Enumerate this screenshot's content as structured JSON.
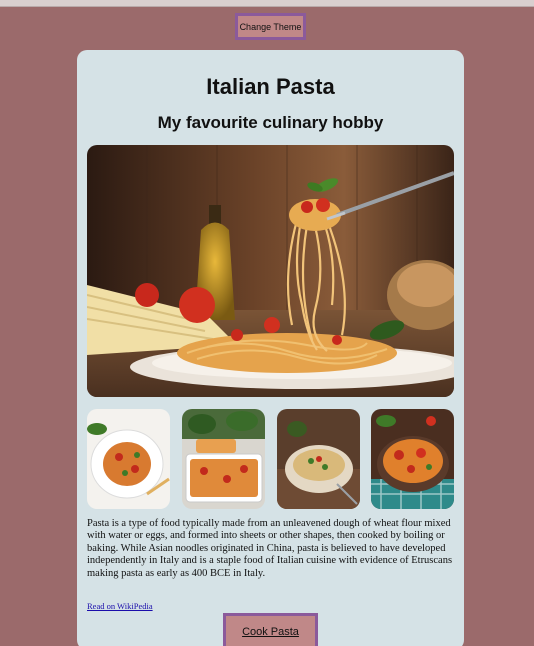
{
  "header": {
    "theme_button_label": "Change Theme"
  },
  "card": {
    "title": "Italian Pasta",
    "subtitle": "My favourite culinary hobby",
    "description": "Pasta is a type of food typically made from an unleavened dough of wheat flour mixed with water or eggs, and formed into sheets or other shapes, then cooked by boiling or baking. While Asian noodles originated in China, pasta is believed to have developed independently in Italy and is a staple food of Italian cuisine with evidence of Etruscans making pasta as early as 400 BCE in Italy.",
    "wiki_link": "Read on WikiPedia",
    "cook_button_label": "Cook Pasta"
  },
  "colors": {
    "page_background": "#9b6a6b",
    "card_background": "#d5e2e6",
    "button_background": "#c08888",
    "button_border": "#8b5a9b",
    "link": "#1a0dab"
  }
}
